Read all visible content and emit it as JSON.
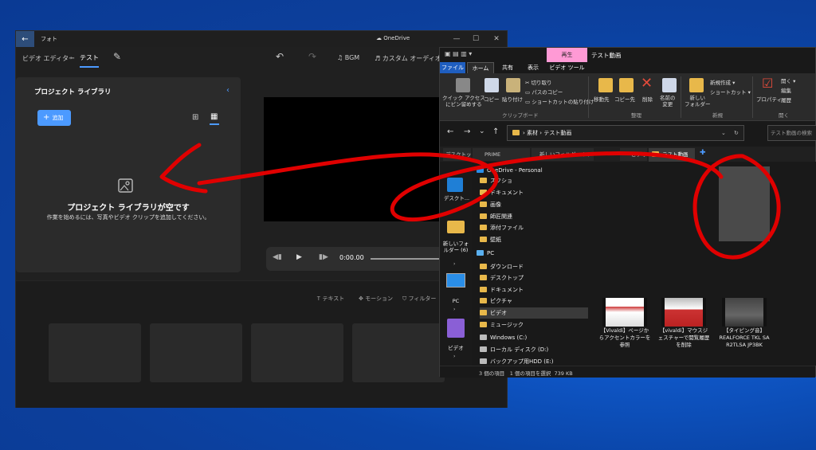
{
  "photos": {
    "title": "フォト",
    "onedrive": "OneDrive",
    "breadcrumb_root": "ビデオ エディター",
    "breadcrumb_sep": "›",
    "project_name": "テスト",
    "bgm_label": "BGM",
    "custom_audio_label": "カスタム オーディオ",
    "library_title": "プロジェクト ライブラリ",
    "add_label": "追加",
    "empty_title": "プロジェクト ライブラリが空です",
    "empty_desc": "作業を始めるには、写真やビデオ クリップを追加してください。",
    "time": "0:00.00",
    "time_end": "0",
    "text_label": "テキスト",
    "motion_label": "モーション",
    "filter_label": "フィルター"
  },
  "explorer": {
    "tab_play": "再生",
    "title": "テスト動画",
    "ribbon_tabs": [
      "ファイル",
      "ホーム",
      "共有",
      "表示",
      "ビデオ ツール"
    ],
    "quick_access": "クイック アクセス\nにピン留めする",
    "copy": "コピー",
    "paste": "貼り付け",
    "cut": "切り取り",
    "copy_path": "パスのコピー",
    "paste_shortcut": "ショートカットの貼り付け",
    "group_clipboard": "クリップボード",
    "move_to": "移動先",
    "copy_to": "コピー先",
    "delete": "削除",
    "rename": "名前の\n変更",
    "group_organize": "整理",
    "new_folder": "新しい\nフォルダー",
    "new_item": "新規作成 ▾",
    "shortcut": "ショートカット ▾",
    "group_new": "新規",
    "properties": "プロパティ",
    "open": "開く ▾",
    "edit": "編集",
    "history": "履歴",
    "group_open": "開く",
    "path": [
      "素材",
      "テスト動画"
    ],
    "search_placeholder": "テスト動画の検索",
    "tabs": [
      "デスクトップ",
      "PRIME",
      "新しいフォルダー (6)",
      "ビデオ",
      "テスト動画"
    ],
    "desktop_items": [
      {
        "label": "デスクト..."
      },
      {
        "label": "新しいフォ\nルダー (6)"
      },
      {
        "label": "PC"
      },
      {
        "label": "ビデオ"
      }
    ],
    "nav": [
      {
        "label": "OneDrive - Personal"
      },
      {
        "label": "スクショ"
      },
      {
        "label": "ドキュメント"
      },
      {
        "label": "画像"
      },
      {
        "label": "師匠関連"
      },
      {
        "label": "添付ファイル"
      },
      {
        "label": "壁紙"
      },
      {
        "label": "PC"
      },
      {
        "label": "ダウンロード"
      },
      {
        "label": "デスクトップ"
      },
      {
        "label": "ドキュメント"
      },
      {
        "label": "ピクチャ"
      },
      {
        "label": "ビデオ"
      },
      {
        "label": "ミュージック"
      },
      {
        "label": "Windows (C:)"
      },
      {
        "label": "ローカル ディスク (D:)"
      },
      {
        "label": "バックアップ用HDD (E:)"
      }
    ],
    "files": [
      {
        "name": "【Vivaldi】ページからアクセントカラーを参照"
      },
      {
        "name": "【vivaldi】マウスジェスチャーで閲覧履歴を削除"
      },
      {
        "name": "【タイピング音】REALFORCE TKL SA R2TLSA JP3BK"
      }
    ],
    "status": "3 個の項目　1 個の項目を選択  739 KB"
  },
  "colors": {
    "accent": "#4c9aff",
    "annotation": "#e00000",
    "play_tab": "#ff9ad5"
  }
}
